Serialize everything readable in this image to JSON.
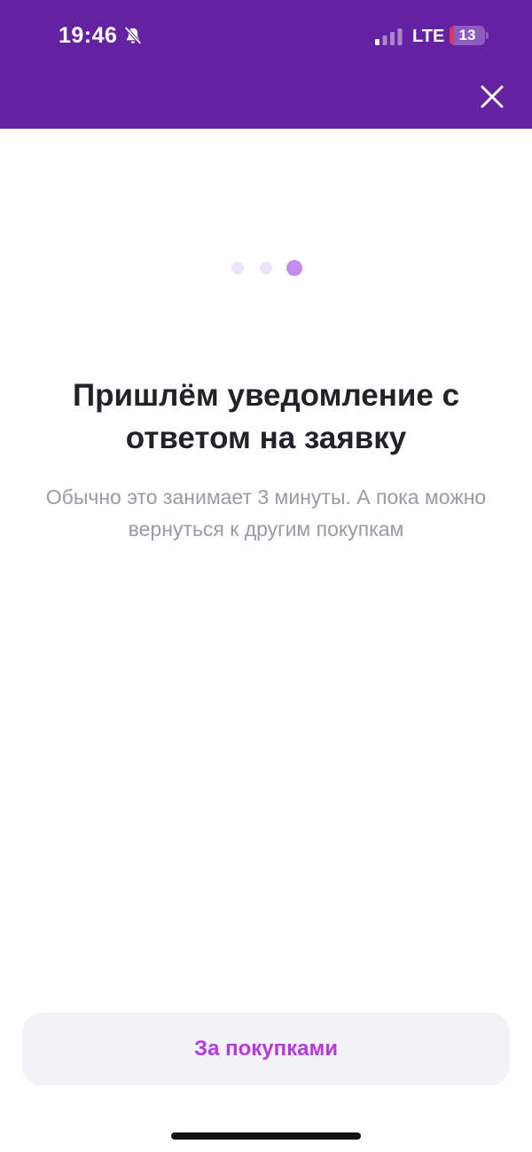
{
  "status_bar": {
    "time": "19:46",
    "network": "LTE",
    "battery_level": "13",
    "silent_icon": "bell-slash-icon",
    "signal_icon": "signal-bars-icon",
    "signal_bars_active": 1,
    "signal_bars_total": 4
  },
  "header": {
    "background_color": "#6422A1",
    "close_icon": "close-icon"
  },
  "pager": {
    "total": 3,
    "current": 3,
    "active_color": "#C28CF0",
    "inactive_color": "#EEE3FB"
  },
  "main": {
    "headline": "Пришлём уведомление с ответом на заявку",
    "subtext": "Обычно это занимает 3 минуты. А пока можно вернуться к другим покупкам"
  },
  "footer": {
    "shop_button_label": "За покупками",
    "accent_color": "#B53AD9"
  }
}
